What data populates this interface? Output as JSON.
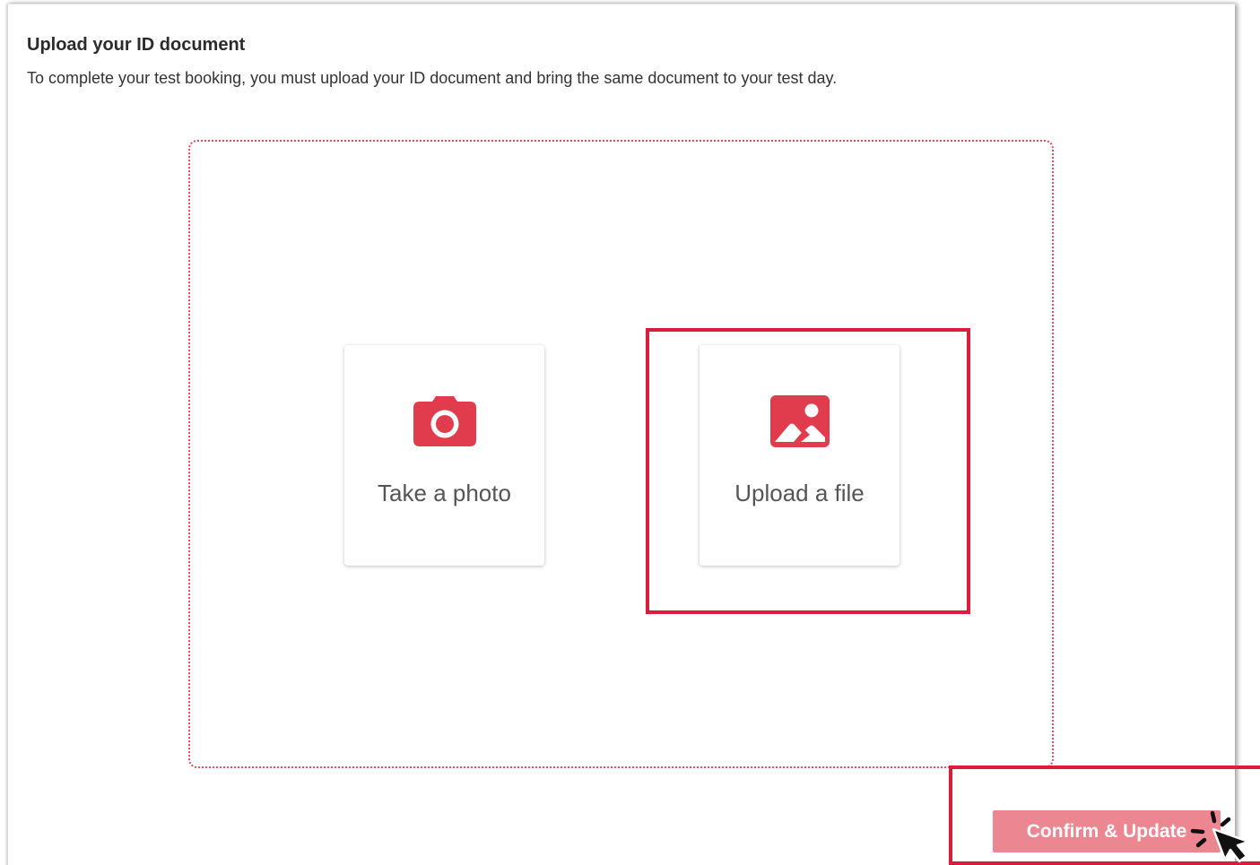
{
  "header": {
    "title": "Upload your ID document",
    "description": "To complete your test booking, you must upload your ID document and bring the same document to your test day."
  },
  "upload_options": [
    {
      "label": "Take a photo",
      "icon": "camera-icon"
    },
    {
      "label": "Upload a file",
      "icon": "image-icon"
    }
  ],
  "footer": {
    "confirm_label": "Confirm & Update"
  },
  "colors": {
    "accent": "#e03c4e",
    "highlight": "#dc1c3c",
    "button": "#ec8792",
    "dropzone_border": "#e34a5c"
  }
}
